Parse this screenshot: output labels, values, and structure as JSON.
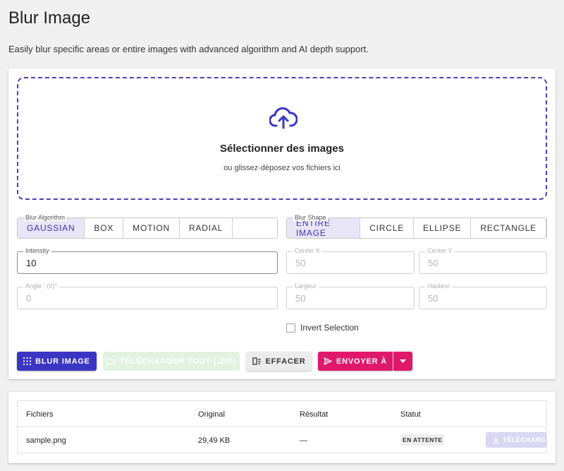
{
  "page": {
    "title": "Blur Image",
    "subtitle": "Easily blur specific areas or entire images with advanced algorithm and AI depth support."
  },
  "dropzone": {
    "title": "Sélectionner des images",
    "subtitle": "ou glissez-déposez vos fichiers ici",
    "icon": "cloud-upload-icon"
  },
  "algorithm": {
    "legend": "Blur Algorithm",
    "options": [
      "GAUSSIAN",
      "BOX",
      "MOTION",
      "RADIAL"
    ],
    "selected": "GAUSSIAN"
  },
  "shape": {
    "legend": "Blur Shape",
    "options": [
      "ENTIRE IMAGE",
      "CIRCLE",
      "ELLIPSE",
      "RECTANGLE"
    ],
    "selected": "ENTIRE IMAGE"
  },
  "fields": {
    "intensity": {
      "label": "Intensity",
      "value": "10"
    },
    "center_x": {
      "label": "Center X",
      "value": "50"
    },
    "center_y": {
      "label": "Center Y",
      "value": "50"
    },
    "angle": {
      "label": "Angle : (0)°",
      "value": "0"
    },
    "largeur": {
      "label": "Largeur",
      "value": "50"
    },
    "hauteur": {
      "label": "Hauteur",
      "value": "50"
    }
  },
  "invert": {
    "label": "Invert Selection",
    "checked": false
  },
  "actions": {
    "blur": "BLUR IMAGE",
    "download_all": "TÉLÉCHARGER TOUT (.ZIP)",
    "clear": "EFFACER",
    "send": "ENVOYER À"
  },
  "table": {
    "headers": [
      "Fichiers",
      "Original",
      "Résultat",
      "Statut"
    ],
    "rows": [
      {
        "file": "sample.png",
        "original": "29,49 KB",
        "result": "—",
        "status": "EN ATTENTE",
        "action": "TÉLÉCHARGER"
      }
    ]
  },
  "colors": {
    "accent": "#3b35c3",
    "send": "#e0186a",
    "dropzone_border": "#4a40b8"
  }
}
